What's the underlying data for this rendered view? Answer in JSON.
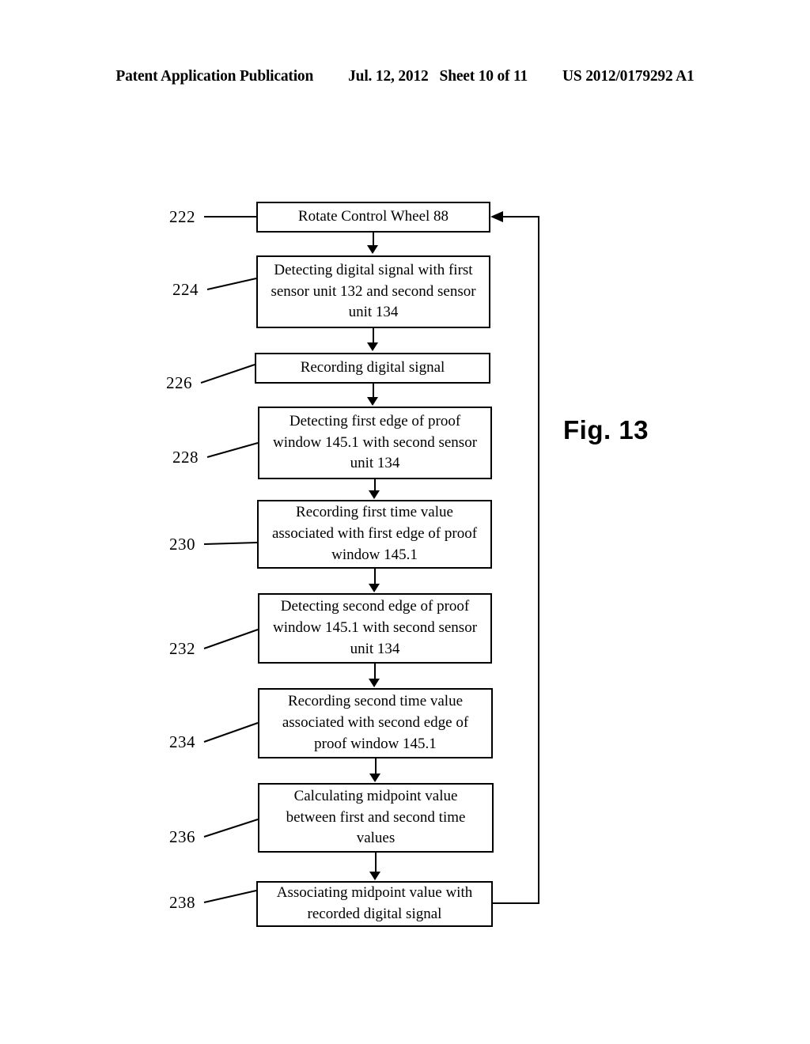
{
  "header": {
    "publication": "Patent Application Publication",
    "date": "Jul. 12, 2012",
    "sheet": "Sheet 10 of 11",
    "patent_number": "US 2012/0179292 A1"
  },
  "figure": {
    "label": "Fig. 13"
  },
  "flowchart": {
    "steps": [
      {
        "ref": "222",
        "text": "Rotate Control Wheel 88"
      },
      {
        "ref": "224",
        "text": "Detecting digital signal with first sensor unit 132 and second sensor unit 134"
      },
      {
        "ref": "226",
        "text": "Recording digital signal"
      },
      {
        "ref": "228",
        "text": "Detecting first edge of proof window 145.1 with second sensor unit 134"
      },
      {
        "ref": "230",
        "text": "Recording first time value associated with first edge of proof window 145.1"
      },
      {
        "ref": "232",
        "text": "Detecting second edge of proof window 145.1 with second sensor unit 134"
      },
      {
        "ref": "234",
        "text": "Recording second time value associated with second edge of proof window 145.1"
      },
      {
        "ref": "236",
        "text": "Calculating midpoint value between first and second time values"
      },
      {
        "ref": "238",
        "text": "Associating midpoint value with recorded digital signal"
      }
    ]
  },
  "colors": {
    "ink": "#000000",
    "paper": "#ffffff"
  }
}
